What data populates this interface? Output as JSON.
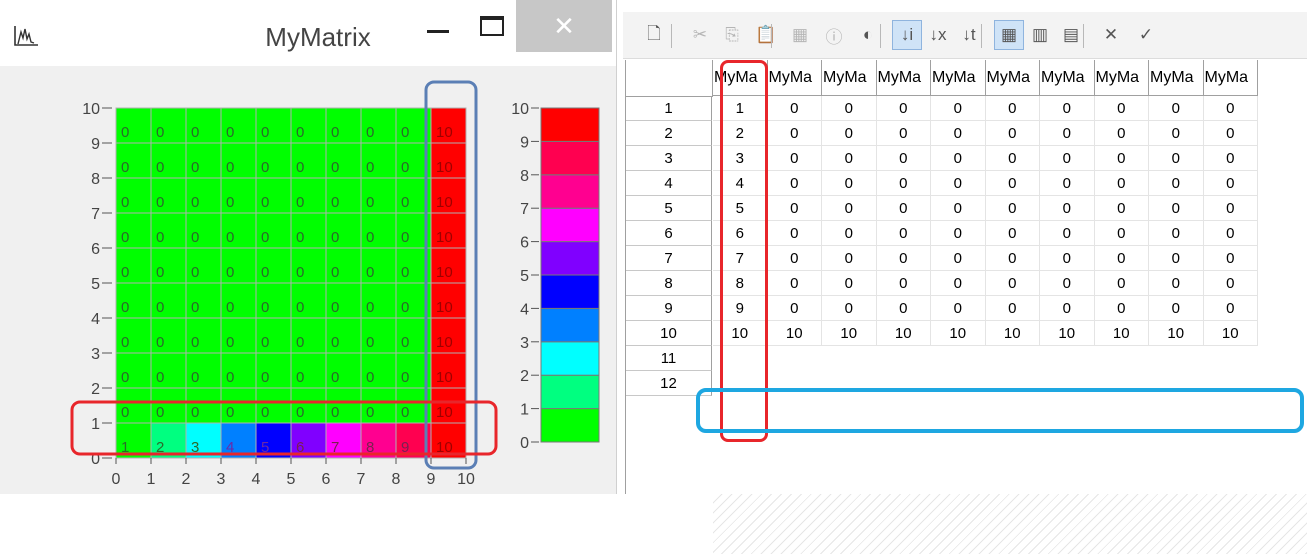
{
  "left_window": {
    "title": "MyMatrix",
    "icons": {
      "app": "chart-icon",
      "minimize": "minimize-icon",
      "maximize": "maximize-icon",
      "close": "close-icon"
    },
    "close_glyph": "✕"
  },
  "right_window": {
    "toolbar": [
      {
        "icon": "document-icon",
        "glyph": "🗋",
        "enabled": true
      },
      {
        "icon": "cut-icon",
        "glyph": "✂",
        "enabled": false
      },
      {
        "icon": "copy-icon",
        "glyph": "⎘",
        "enabled": false
      },
      {
        "icon": "paste-icon",
        "glyph": "📋",
        "enabled": true
      },
      {
        "icon": "chart-icon",
        "glyph": "▦",
        "enabled": false
      },
      {
        "icon": "info-icon",
        "glyph": "ⓘ",
        "enabled": false
      },
      {
        "icon": "view-icon",
        "glyph": "◐",
        "enabled": true
      },
      {
        "icon": "sort-ascending-icon",
        "glyph": "↓i",
        "enabled": true,
        "active": true
      },
      {
        "icon": "sort-x-icon",
        "glyph": "↓x",
        "enabled": true
      },
      {
        "icon": "sort-t-icon",
        "glyph": "↓t",
        "enabled": true
      },
      {
        "icon": "grid-icon",
        "glyph": "▦",
        "enabled": true,
        "active": true
      },
      {
        "icon": "grid-columns-icon",
        "glyph": "▥",
        "enabled": true
      },
      {
        "icon": "grid-rows-icon",
        "glyph": "▤",
        "enabled": true
      },
      {
        "icon": "cancel-icon",
        "glyph": "✕",
        "enabled": true
      },
      {
        "icon": "accept-icon",
        "glyph": "✓",
        "enabled": true
      }
    ],
    "column_headers": [
      "MyMa",
      "MyMa",
      "MyMa",
      "MyMa",
      "MyMa",
      "MyMa",
      "MyMa",
      "MyMa",
      "MyMa",
      "MyMa"
    ],
    "row_headers": [
      "1",
      "2",
      "3",
      "4",
      "5",
      "6",
      "7",
      "8",
      "9",
      "10",
      "11",
      "12"
    ],
    "rows": [
      [
        "1",
        "0",
        "0",
        "0",
        "0",
        "0",
        "0",
        "0",
        "0",
        "0"
      ],
      [
        "2",
        "0",
        "0",
        "0",
        "0",
        "0",
        "0",
        "0",
        "0",
        "0"
      ],
      [
        "3",
        "0",
        "0",
        "0",
        "0",
        "0",
        "0",
        "0",
        "0",
        "0"
      ],
      [
        "4",
        "0",
        "0",
        "0",
        "0",
        "0",
        "0",
        "0",
        "0",
        "0"
      ],
      [
        "5",
        "0",
        "0",
        "0",
        "0",
        "0",
        "0",
        "0",
        "0",
        "0"
      ],
      [
        "6",
        "0",
        "0",
        "0",
        "0",
        "0",
        "0",
        "0",
        "0",
        "0"
      ],
      [
        "7",
        "0",
        "0",
        "0",
        "0",
        "0",
        "0",
        "0",
        "0",
        "0"
      ],
      [
        "8",
        "0",
        "0",
        "0",
        "0",
        "0",
        "0",
        "0",
        "0",
        "0"
      ],
      [
        "9",
        "0",
        "0",
        "0",
        "0",
        "0",
        "0",
        "0",
        "0",
        "0"
      ],
      [
        "10",
        "10",
        "10",
        "10",
        "10",
        "10",
        "10",
        "10",
        "10",
        "10"
      ]
    ]
  },
  "chart_data": [
    {
      "type": "heatmap",
      "x_ticks": [
        "0",
        "1",
        "2",
        "3",
        "4",
        "5",
        "6",
        "7",
        "8",
        "9",
        "10"
      ],
      "y_ticks": [
        "0",
        "1",
        "2",
        "3",
        "4",
        "5",
        "6",
        "7",
        "8",
        "9",
        "10"
      ],
      "xlim": [
        0,
        10
      ],
      "ylim": [
        0,
        10
      ],
      "grid": true,
      "matrix": [
        [
          1,
          2,
          3,
          4,
          5,
          6,
          7,
          8,
          9,
          10
        ],
        [
          0,
          0,
          0,
          0,
          0,
          0,
          0,
          0,
          0,
          10
        ],
        [
          0,
          0,
          0,
          0,
          0,
          0,
          0,
          0,
          0,
          10
        ],
        [
          0,
          0,
          0,
          0,
          0,
          0,
          0,
          0,
          0,
          10
        ],
        [
          0,
          0,
          0,
          0,
          0,
          0,
          0,
          0,
          0,
          10
        ],
        [
          0,
          0,
          0,
          0,
          0,
          0,
          0,
          0,
          0,
          10
        ],
        [
          0,
          0,
          0,
          0,
          0,
          0,
          0,
          0,
          0,
          10
        ],
        [
          0,
          0,
          0,
          0,
          0,
          0,
          0,
          0,
          0,
          10
        ],
        [
          0,
          0,
          0,
          0,
          0,
          0,
          0,
          0,
          0,
          10
        ],
        [
          0,
          0,
          0,
          0,
          0,
          0,
          0,
          0,
          0,
          10
        ]
      ]
    },
    {
      "type": "heatmap",
      "title": "",
      "y_ticks": [
        "0",
        "1",
        "2",
        "3",
        "4",
        "5",
        "6",
        "7",
        "8",
        "9",
        "10"
      ],
      "ylim": [
        0,
        10
      ],
      "color_scale": [
        "#00ff00",
        "#00ff80",
        "#00ffff",
        "#0080ff",
        "#0000ff",
        "#8000ff",
        "#ff00ff",
        "#ff0090",
        "#ff0050",
        "#ff0000"
      ]
    }
  ],
  "colors": {
    "highlight_red": "#e8262b",
    "highlight_blue": "#5b7fb5",
    "highlight_cyan": "#1ea7e1",
    "grid_line": "#b0b0b0"
  }
}
